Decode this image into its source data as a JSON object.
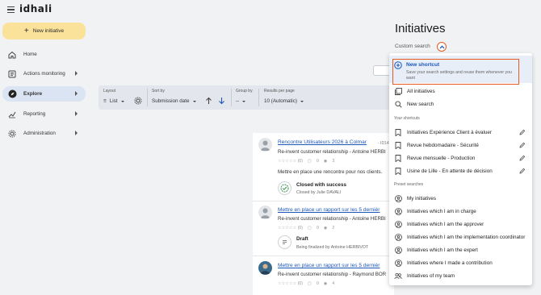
{
  "app": {
    "logo": "idhali"
  },
  "sidebar": {
    "new_button": "New initiative",
    "items": [
      {
        "label": "Home",
        "icon": "home-icon"
      },
      {
        "label": "Actions monitoring",
        "icon": "checklist-icon"
      },
      {
        "label": "Explore",
        "icon": "compass-icon"
      },
      {
        "label": "Reporting",
        "icon": "chart-icon"
      },
      {
        "label": "Administration",
        "icon": "gear-icon"
      }
    ]
  },
  "header": {
    "title": "Initiatives",
    "custom_search": "Custom search"
  },
  "toolbar": {
    "layout_label": "Layout",
    "layout_value": "List",
    "sort_label": "Sort by",
    "sort_value": "Submission date",
    "group_label": "Group by",
    "group_value": "--",
    "results_label": "Results per page",
    "results_value": "10 (Automatic)"
  },
  "cards": [
    {
      "title": "Rencontre Utilisateurs 2026 à Colmar",
      "meta": "- ID14",
      "subtitle": "Re-invent customer relationship - Antoine HERBI",
      "rating": "☆☆☆☆☆ (0)",
      "comments": "0",
      "views": "3",
      "description": "Mettre en place une rencontre pour nos clients.",
      "status_title": "Closed with success",
      "status_sub": "Closed by Julie DAVALI"
    },
    {
      "title": "Mettre en place un rapport sur les 5 dernièr",
      "meta": "",
      "subtitle": "Re-invent customer relationship - Antoine HERBI",
      "rating": "☆☆☆☆☆ (0)",
      "comments": "0",
      "views": "2",
      "description": "",
      "status_title": "Draft",
      "status_sub": "Being finalized by Antoine HERBIVOT"
    },
    {
      "title": "Mettre en place un rapport sur les 5 dernièr",
      "meta": "",
      "subtitle": "Re-invent customer relationship - Raymond BOR",
      "rating": "☆☆☆☆☆ (0)",
      "comments": "0",
      "views": "4",
      "description": "",
      "status_title": "",
      "status_sub": ""
    }
  ],
  "dropdown": {
    "new_shortcut_title": "New shortcut",
    "new_shortcut_sub": "Save your search settings and reuse them whenever you want",
    "top_items": [
      {
        "label": "All initiatives",
        "icon": "stack-icon"
      },
      {
        "label": "New search",
        "icon": "search-icon"
      }
    ],
    "shortcuts_header": "Your shortcuts",
    "shortcuts": [
      {
        "label": "Initiatives Expérience Client à évaluer"
      },
      {
        "label": "Revue hebdomadaire - Sécurité"
      },
      {
        "label": "Revue mensuelle - Production"
      },
      {
        "label": "Usine de Lille - En attente de décision"
      }
    ],
    "presets_header": "Preset searches",
    "presets": [
      {
        "label": "My initiatives"
      },
      {
        "label": "Initiatives which I am in charge"
      },
      {
        "label": "Initiatives which I am the approver"
      },
      {
        "label": "Initiatives which I am the implementation coordinator"
      },
      {
        "label": "Initiatives which I am the expert"
      },
      {
        "label": "Initiatives where I made a contribution"
      },
      {
        "label": "Initiatives of my team"
      }
    ]
  },
  "colors": {
    "accent": "#1d57b8",
    "highlight_border": "#e85a20",
    "new_button_bg": "#fbe29a",
    "active_nav_bg": "#dbe4f3"
  }
}
